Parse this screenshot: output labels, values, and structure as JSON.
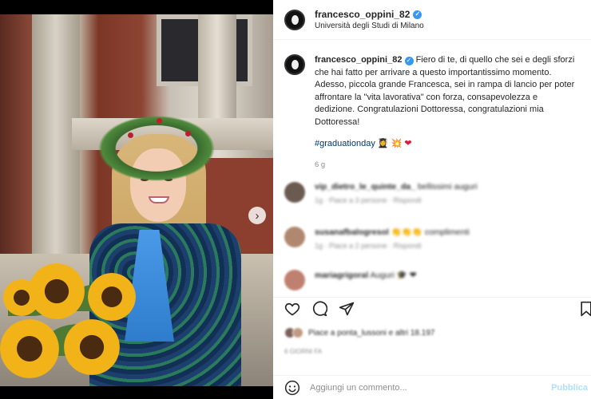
{
  "post": {
    "username": "francesco_oppini_82",
    "location": "Università degli Studi di Milano"
  },
  "caption": {
    "username": "francesco_oppini_82",
    "text": "Fiero di te, di quello che sei e degli sforzi che hai fatto per arrivare a questo importantissimo momento. Adesso, piccola grande Francesca, sei in rampa di lancio per poter affrontare la \"vita lavorativa\" con forza, consapevolezza e dedizione. Congratulazioni Dottoressa, congratulazioni mia Dottoressa!",
    "hashtag": "#graduationday",
    "emojis": "👩‍🎓 💥",
    "heart": "❤",
    "age": "6 g"
  },
  "comments": [
    {
      "user": "vip_dietro_le_quinte_da_",
      "text": "bellissimi auguri",
      "meta": "1g · Piace a 3 persone · Rispondi",
      "avatar_color": "#6b5a50"
    },
    {
      "user": "susanafbalogresol",
      "text": "👏👏👏 complimenti",
      "meta": "1g · Piace a 2 persone · Rispondi",
      "avatar_color": "#b08870"
    },
    {
      "user": "mariagrigoral",
      "text": "Auguri 🎓 ❤",
      "meta": "",
      "avatar_color": "#c08070"
    }
  ],
  "likes": {
    "text": "Piace a ponta_lussoni e altri 18.197",
    "date": "6 GIORNI FA"
  },
  "comment_bar": {
    "placeholder": "Aggiungi un commento...",
    "publish": "Pubblica"
  },
  "icons": {
    "like": "heart-icon",
    "comment": "comment-icon",
    "share": "paper-plane-icon",
    "save": "bookmark-icon",
    "emoji": "smiley-icon",
    "next": "chevron-right-icon"
  },
  "colors": {
    "verified": "#3897f0",
    "hashtag": "#00376b",
    "heart": "#e0193d",
    "publish": "#b2dffc"
  },
  "carousel": {
    "slides": 2,
    "active": 1
  }
}
